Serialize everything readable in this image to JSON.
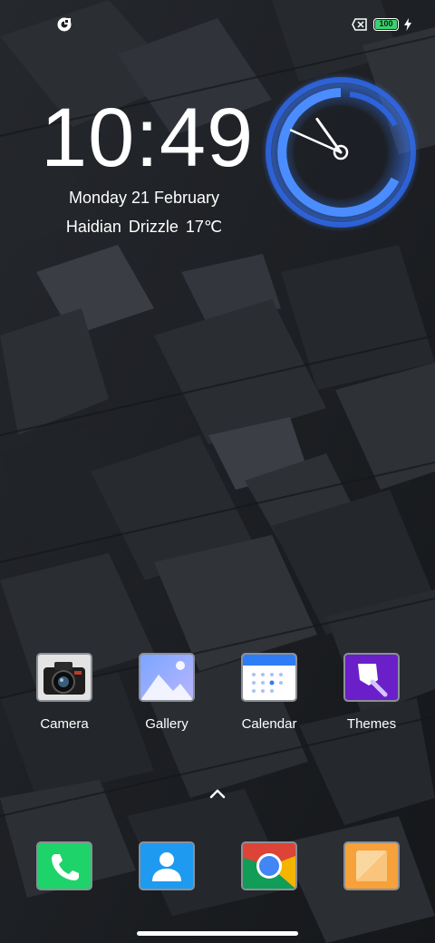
{
  "status_bar": {
    "battery_level": "100",
    "battery_fraction": 1.0,
    "icons": [
      "notification-app-icon",
      "no-sim-icon",
      "battery-icon",
      "charging-icon"
    ]
  },
  "clock_widget": {
    "time": "10:49",
    "date": "Monday 21 February",
    "weather": "Haidian  Drizzle  17℃"
  },
  "analog_clock": {
    "hour": 10,
    "minute": 49,
    "accent_color": "#3a7bff"
  },
  "apps": [
    {
      "label": "Camera",
      "icon": "camera-icon"
    },
    {
      "label": "Gallery",
      "icon": "gallery-icon"
    },
    {
      "label": "Calendar",
      "icon": "calendar-icon"
    },
    {
      "label": "Themes",
      "icon": "themes-icon"
    }
  ],
  "dock": [
    {
      "icon": "phone-icon",
      "color": "#1fd36b"
    },
    {
      "icon": "contacts-icon",
      "color": "#1e9bf0"
    },
    {
      "icon": "chrome-icon",
      "color": "#db4437"
    },
    {
      "icon": "notes-icon",
      "color": "#f7a13a"
    }
  ],
  "app_drawer": {
    "icon": "chevron-up-icon"
  },
  "colors": {
    "wallpaper": "#1b1e22",
    "battery_green": "#3cd070"
  }
}
